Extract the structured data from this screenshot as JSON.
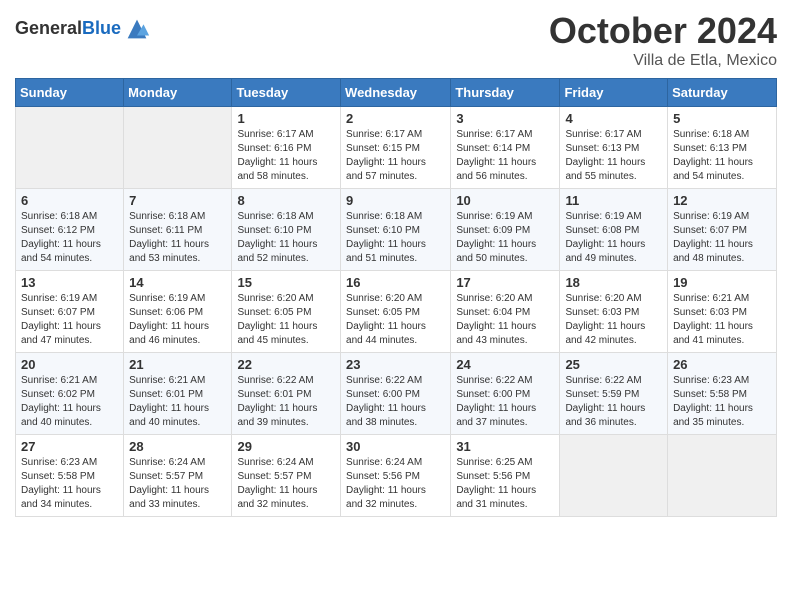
{
  "logo": {
    "general": "General",
    "blue": "Blue"
  },
  "header": {
    "month": "October 2024",
    "location": "Villa de Etla, Mexico"
  },
  "weekdays": [
    "Sunday",
    "Monday",
    "Tuesday",
    "Wednesday",
    "Thursday",
    "Friday",
    "Saturday"
  ],
  "weeks": [
    [
      {
        "day": null
      },
      {
        "day": null
      },
      {
        "day": 1,
        "sunrise": "6:17 AM",
        "sunset": "6:16 PM",
        "daylight": "11 hours and 58 minutes."
      },
      {
        "day": 2,
        "sunrise": "6:17 AM",
        "sunset": "6:15 PM",
        "daylight": "11 hours and 57 minutes."
      },
      {
        "day": 3,
        "sunrise": "6:17 AM",
        "sunset": "6:14 PM",
        "daylight": "11 hours and 56 minutes."
      },
      {
        "day": 4,
        "sunrise": "6:17 AM",
        "sunset": "6:13 PM",
        "daylight": "11 hours and 55 minutes."
      },
      {
        "day": 5,
        "sunrise": "6:18 AM",
        "sunset": "6:13 PM",
        "daylight": "11 hours and 54 minutes."
      }
    ],
    [
      {
        "day": 6,
        "sunrise": "6:18 AM",
        "sunset": "6:12 PM",
        "daylight": "11 hours and 54 minutes."
      },
      {
        "day": 7,
        "sunrise": "6:18 AM",
        "sunset": "6:11 PM",
        "daylight": "11 hours and 53 minutes."
      },
      {
        "day": 8,
        "sunrise": "6:18 AM",
        "sunset": "6:10 PM",
        "daylight": "11 hours and 52 minutes."
      },
      {
        "day": 9,
        "sunrise": "6:18 AM",
        "sunset": "6:10 PM",
        "daylight": "11 hours and 51 minutes."
      },
      {
        "day": 10,
        "sunrise": "6:19 AM",
        "sunset": "6:09 PM",
        "daylight": "11 hours and 50 minutes."
      },
      {
        "day": 11,
        "sunrise": "6:19 AM",
        "sunset": "6:08 PM",
        "daylight": "11 hours and 49 minutes."
      },
      {
        "day": 12,
        "sunrise": "6:19 AM",
        "sunset": "6:07 PM",
        "daylight": "11 hours and 48 minutes."
      }
    ],
    [
      {
        "day": 13,
        "sunrise": "6:19 AM",
        "sunset": "6:07 PM",
        "daylight": "11 hours and 47 minutes."
      },
      {
        "day": 14,
        "sunrise": "6:19 AM",
        "sunset": "6:06 PM",
        "daylight": "11 hours and 46 minutes."
      },
      {
        "day": 15,
        "sunrise": "6:20 AM",
        "sunset": "6:05 PM",
        "daylight": "11 hours and 45 minutes."
      },
      {
        "day": 16,
        "sunrise": "6:20 AM",
        "sunset": "6:05 PM",
        "daylight": "11 hours and 44 minutes."
      },
      {
        "day": 17,
        "sunrise": "6:20 AM",
        "sunset": "6:04 PM",
        "daylight": "11 hours and 43 minutes."
      },
      {
        "day": 18,
        "sunrise": "6:20 AM",
        "sunset": "6:03 PM",
        "daylight": "11 hours and 42 minutes."
      },
      {
        "day": 19,
        "sunrise": "6:21 AM",
        "sunset": "6:03 PM",
        "daylight": "11 hours and 41 minutes."
      }
    ],
    [
      {
        "day": 20,
        "sunrise": "6:21 AM",
        "sunset": "6:02 PM",
        "daylight": "11 hours and 40 minutes."
      },
      {
        "day": 21,
        "sunrise": "6:21 AM",
        "sunset": "6:01 PM",
        "daylight": "11 hours and 40 minutes."
      },
      {
        "day": 22,
        "sunrise": "6:22 AM",
        "sunset": "6:01 PM",
        "daylight": "11 hours and 39 minutes."
      },
      {
        "day": 23,
        "sunrise": "6:22 AM",
        "sunset": "6:00 PM",
        "daylight": "11 hours and 38 minutes."
      },
      {
        "day": 24,
        "sunrise": "6:22 AM",
        "sunset": "6:00 PM",
        "daylight": "11 hours and 37 minutes."
      },
      {
        "day": 25,
        "sunrise": "6:22 AM",
        "sunset": "5:59 PM",
        "daylight": "11 hours and 36 minutes."
      },
      {
        "day": 26,
        "sunrise": "6:23 AM",
        "sunset": "5:58 PM",
        "daylight": "11 hours and 35 minutes."
      }
    ],
    [
      {
        "day": 27,
        "sunrise": "6:23 AM",
        "sunset": "5:58 PM",
        "daylight": "11 hours and 34 minutes."
      },
      {
        "day": 28,
        "sunrise": "6:24 AM",
        "sunset": "5:57 PM",
        "daylight": "11 hours and 33 minutes."
      },
      {
        "day": 29,
        "sunrise": "6:24 AM",
        "sunset": "5:57 PM",
        "daylight": "11 hours and 32 minutes."
      },
      {
        "day": 30,
        "sunrise": "6:24 AM",
        "sunset": "5:56 PM",
        "daylight": "11 hours and 32 minutes."
      },
      {
        "day": 31,
        "sunrise": "6:25 AM",
        "sunset": "5:56 PM",
        "daylight": "11 hours and 31 minutes."
      },
      {
        "day": null
      },
      {
        "day": null
      }
    ]
  ],
  "labels": {
    "sunrise": "Sunrise:",
    "sunset": "Sunset:",
    "daylight": "Daylight:"
  }
}
